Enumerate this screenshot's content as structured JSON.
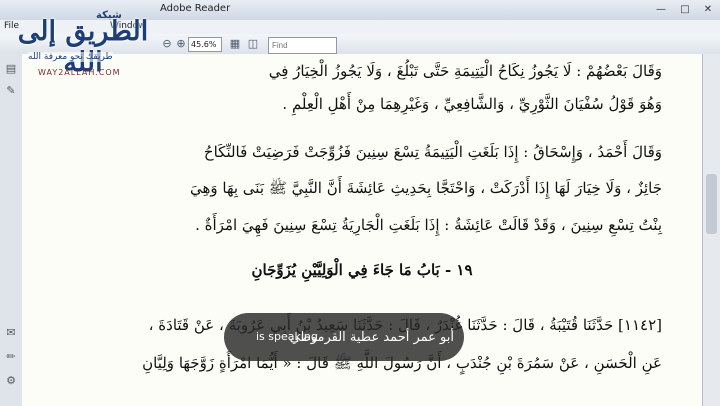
{
  "window": {
    "title": "Adobe Reader"
  },
  "menu": {
    "file": "File",
    "window": "Window"
  },
  "toolbar": {
    "zoom": "45.6%",
    "find_placeholder": "Find"
  },
  "logo": {
    "top_word": "شبكة",
    "name": "الطريق إلى الله",
    "tagline": "طريقك نحو معرفة الله",
    "site": "WAY2ALLAH.COM"
  },
  "document": {
    "line1": "وَقَالَ بَعْضُهُمْ : لَا يَجُوزُ نِكَاحُ الْيَتِيمَةِ حَتَّى تَبْلُغَ ، وَلَا يَجُوزُ الْخِيَارُ فِي",
    "line2": "وَهُوَ قَوْلُ سُفْيَانَ الثَّوْرِيِّ ، وَالشَّافِعِيِّ ، وَغَيْرِهِمَا مِنْ أَهْلِ الْعِلْمِ .",
    "line3": "وَقَالَ أَحْمَدُ ، وَإِسْحَاقُ : إِذَا بَلَغَتِ الْيَتِيمَةُ تِسْعَ سِنِينَ فَزُوِّجَتْ فَرَضِيَتْ فَالنِّكَاحُ",
    "line4": "جَائِزٌ ، وَلَا خِيَارَ لَهَا إِذَا أَدْرَكَتْ ، وَاحْتَجَّا بِحَدِيثِ عَائِشَةَ أَنَّ النَّبِيَّ ﷺ بَنَى بِهَا وَهِيَ",
    "line5": "بِنْتُ تِسْعِ سِنِينَ ، وَقَدْ قَالَتْ عَائِشَةُ : إِذَا بَلَغَتِ الْجَارِيَةُ تِسْعَ سِنِينَ فَهِيَ امْرَأَةٌ .",
    "heading": "١٩ - بَابُ مَا جَاءَ فِي الْوَلِيَّيْنِ يُزَوِّجَانِ",
    "line6": "[١١٤٢] حَدَّثَنَا قُتَيْبَةُ ، قَالَ : حَدَّثَنَا غُنْدَرٌ ، قَالَ : حَدَّثَنَا سَعِيدُ بْنُ أَبِي عَرُوبَةَ ، عَنْ قَتَادَةَ ،",
    "line7": "عَنِ الْحَسَنِ ، عَنْ سَمُرَةَ بْنِ جُنْدَبٍ ، أَنَّ رَسُولَ اللَّهِ ﷺ قَالَ : « أَيُّمَا امْرَأَةٍ زَوَّجَهَا وَلِيَّانِ"
  },
  "caption": {
    "speaker": "أبو عمر أحمد عطية القرموطي",
    "suffix": "is speaking"
  }
}
